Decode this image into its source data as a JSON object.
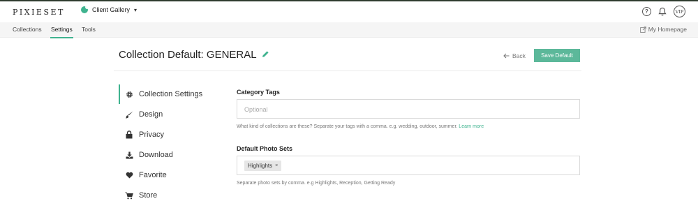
{
  "brand": {
    "logo": "PIXIESET",
    "accent": "#3fb38f",
    "button_color": "#5cb89a"
  },
  "app_switcher": {
    "label": "Client Gallery"
  },
  "top_icons": {
    "help": "help-icon",
    "notifications": "bell-icon",
    "badge": "VIP"
  },
  "subnav": {
    "tabs": [
      {
        "label": "Collections"
      },
      {
        "label": "Settings"
      },
      {
        "label": "Tools"
      }
    ],
    "active_tab": "Settings",
    "homepage_link": "My Homepage"
  },
  "header": {
    "title": "Collection Default: GENERAL",
    "back_label": "Back",
    "save_label": "Save Default"
  },
  "sidebar": {
    "items": [
      {
        "label": "Collection Settings",
        "icon": "gear-icon"
      },
      {
        "label": "Design",
        "icon": "brush-icon"
      },
      {
        "label": "Privacy",
        "icon": "lock-icon"
      },
      {
        "label": "Download",
        "icon": "download-icon"
      },
      {
        "label": "Favorite",
        "icon": "heart-icon"
      },
      {
        "label": "Store",
        "icon": "cart-icon"
      }
    ],
    "active": "Collection Settings"
  },
  "form": {
    "category_tags": {
      "label": "Category Tags",
      "placeholder": "Optional",
      "value": "",
      "help": "What kind of collections are these? Separate your tags with a comma. e.g. wedding, outdoor, summer.",
      "help_link": "Learn more"
    },
    "photo_sets": {
      "label": "Default Photo Sets",
      "chips": [
        {
          "label": "Highlights"
        }
      ],
      "help": "Separate photo sets by comma. e.g Highlights, Reception, Getting Ready"
    }
  }
}
